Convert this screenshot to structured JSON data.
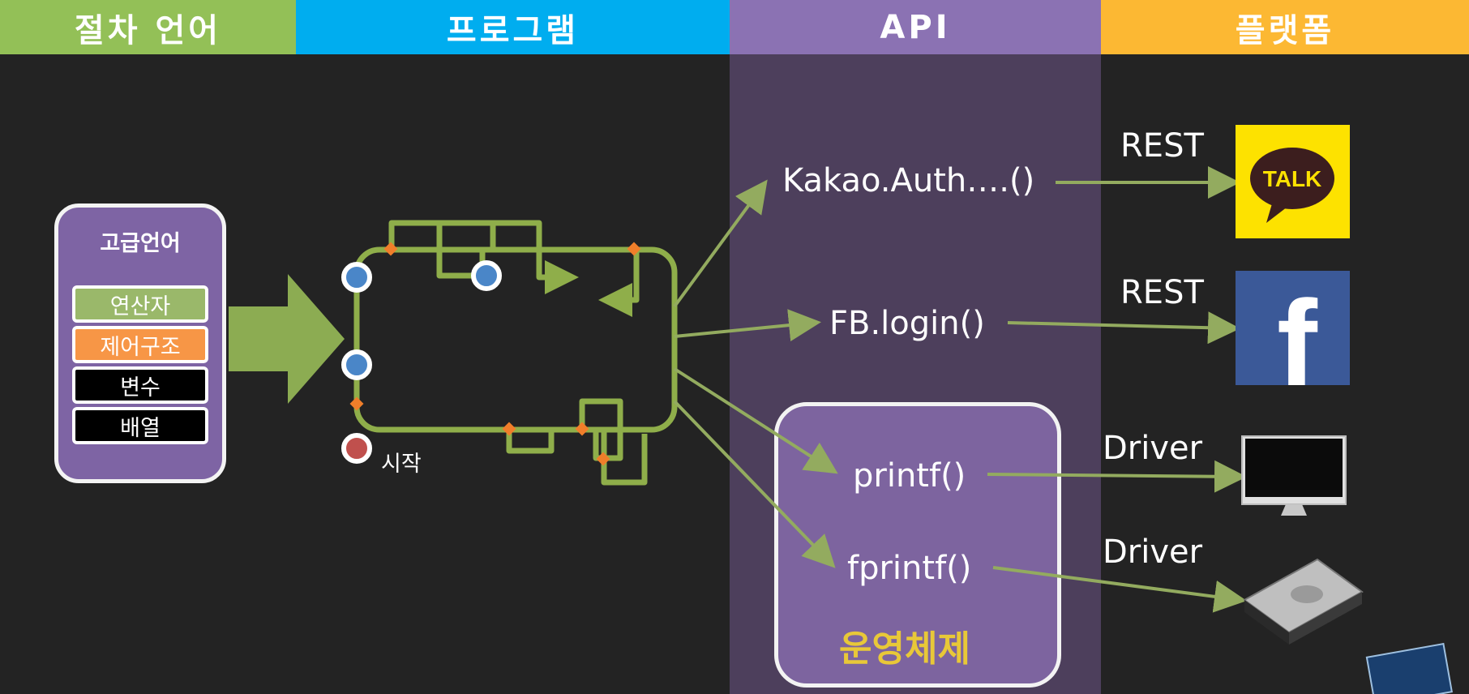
{
  "headers": [
    {
      "label": "절차 언어",
      "color": "#93c057"
    },
    {
      "label": "프로그램",
      "color": "#00adef"
    },
    {
      "label": "API",
      "color": "#8b72b3"
    },
    {
      "label": "플랫폼",
      "color": "#fcb833"
    }
  ],
  "high_level_card": {
    "title": "고급언어",
    "items": [
      {
        "label": "연산자",
        "bg": "#9ab86a",
        "fg": "#ffffff"
      },
      {
        "label": "제어구조",
        "bg": "#f79646",
        "fg": "#ffffff"
      },
      {
        "label": "변수",
        "bg": "#000000",
        "fg": "#ffffff"
      },
      {
        "label": "배열",
        "bg": "#000000",
        "fg": "#ffffff"
      }
    ]
  },
  "flow": {
    "start_label": "시작"
  },
  "api_calls": [
    "Kakao.Auth….()",
    "FB.login()",
    "printf()",
    "fprintf()"
  ],
  "os_label": "운영체제",
  "connections": [
    "REST",
    "REST",
    "Driver",
    "Driver"
  ],
  "platforms": [
    {
      "name": "kakaotalk",
      "text": "TALK"
    },
    {
      "name": "facebook",
      "text": "f"
    },
    {
      "name": "monitor",
      "text": ""
    },
    {
      "name": "hard-disk",
      "text": ""
    }
  ],
  "colors": {
    "arrow": "#93ab5f",
    "flow_line": "#8fae4a",
    "background": "#232323",
    "api_band": "#4d3f5c"
  }
}
